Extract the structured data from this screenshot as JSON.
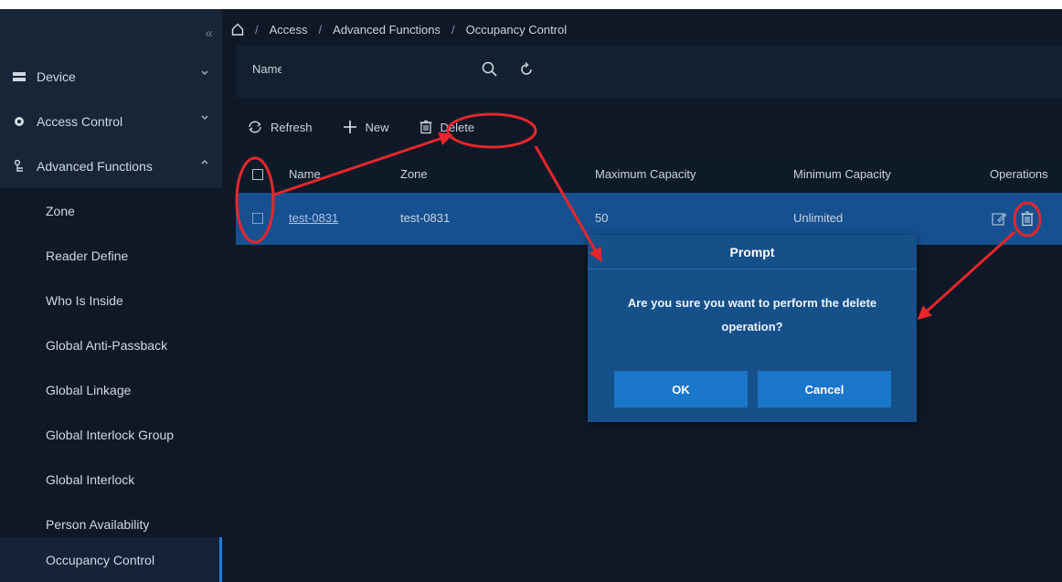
{
  "sidebar": {
    "collapse_glyph": "«",
    "items": [
      {
        "label": "Device",
        "icon": "device-icon"
      },
      {
        "label": "Access Control",
        "icon": "gear-icon"
      },
      {
        "label": "Advanced Functions",
        "icon": "hierarchy-icon"
      }
    ],
    "sub_items": [
      {
        "label": "Zone"
      },
      {
        "label": "Reader Define"
      },
      {
        "label": "Who Is Inside"
      },
      {
        "label": "Global Anti-Passback"
      },
      {
        "label": "Global Linkage"
      },
      {
        "label": "Global Interlock Group"
      },
      {
        "label": "Global Interlock"
      },
      {
        "label": "Person Availability"
      },
      {
        "label": "Occupancy Control"
      }
    ],
    "active_item": "Occupancy Control"
  },
  "breadcrumb": {
    "separator": "/",
    "items": [
      "Access",
      "Advanced Functions",
      "Occupancy Control"
    ]
  },
  "search": {
    "label": "Name",
    "value": ""
  },
  "toolbar": {
    "refresh_label": "Refresh",
    "new_label": "New",
    "delete_label": "Delete"
  },
  "table": {
    "columns": [
      "Name",
      "Zone",
      "Maximum Capacity",
      "Minimum Capacity",
      "Operations"
    ],
    "rows": [
      {
        "name": "test-0831",
        "zone": "test-0831",
        "max": "50",
        "min": "Unlimited"
      }
    ]
  },
  "dialog": {
    "title": "Prompt",
    "message": "Are you sure you want to perform the delete operation?",
    "ok_label": "OK",
    "cancel_label": "Cancel"
  },
  "colors": {
    "background": "#0e1827",
    "sidebar": "#172536",
    "selected_row": "#165090",
    "dialog": "#155089",
    "button": "#1a76c9",
    "annotation": "#e8262b"
  }
}
